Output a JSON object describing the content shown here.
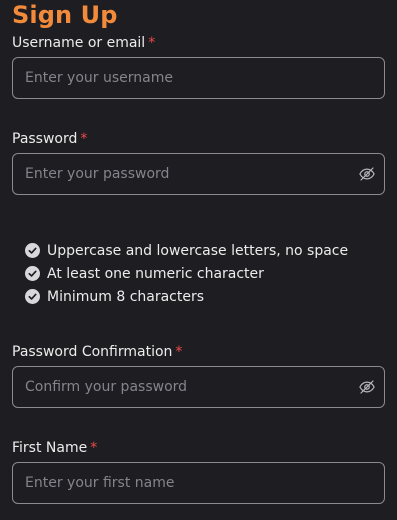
{
  "title": "Sign Up",
  "required_mark": "*",
  "fields": {
    "username": {
      "label": "Username or email",
      "placeholder": "Enter your username"
    },
    "password": {
      "label": "Password",
      "placeholder": "Enter your password",
      "icon": "eye-off-icon"
    },
    "password_confirmation": {
      "label": "Password Confirmation",
      "placeholder": "Confirm your password",
      "icon": "eye-off-icon"
    },
    "first_name": {
      "label": "First Name",
      "placeholder": "Enter your first name"
    }
  },
  "password_rules": [
    {
      "text": "Uppercase and lowercase letters, no space",
      "icon": "check-circle-icon"
    },
    {
      "text": "At least one numeric character",
      "icon": "check-circle-icon"
    },
    {
      "text": "Minimum 8 characters",
      "icon": "check-circle-icon"
    }
  ],
  "colors": {
    "background": "#1e1d21",
    "accent": "#f28a3c",
    "required": "#ef4a4a",
    "border": "#8b8a90",
    "placeholder": "#85848a",
    "text": "#ececec"
  }
}
